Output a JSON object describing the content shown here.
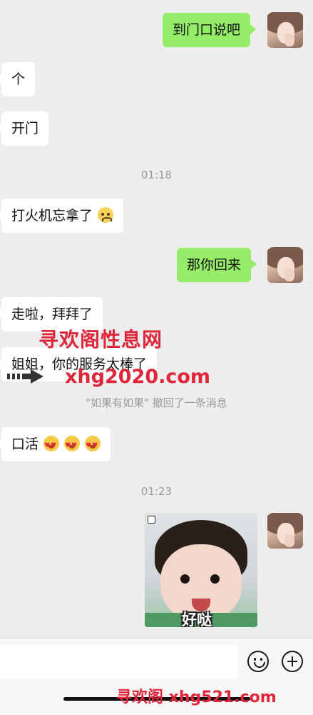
{
  "messages": {
    "m1": "到门口说吧",
    "m2": "个",
    "m3": "开门",
    "m4": "打火机忘拿了",
    "m5": "那你回来",
    "m6": "走啦，拜拜了",
    "m7": "姐姐，你的服务太棒了",
    "m8": "口活"
  },
  "timestamps": {
    "t1": "01:18",
    "t2": "01:23"
  },
  "recall_notice": "\"如果有如果\" 撤回了一条消息",
  "sticker": {
    "caption": "好哒"
  },
  "watermarks": {
    "top_line1": "寻欢阁性息网",
    "top_line2": "xhg2020.com",
    "bottom": "寻欢阁 xhg521.com"
  },
  "icons": [
    "sticker-emoji-icon",
    "add-more-icon",
    "worried-face-emoji",
    "heart-eyes-emoji"
  ],
  "colors": {
    "outgoing_bubble": "#95ec69",
    "incoming_bubble": "#ffffff",
    "background": "#ededed",
    "watermark": "#e0263b"
  }
}
